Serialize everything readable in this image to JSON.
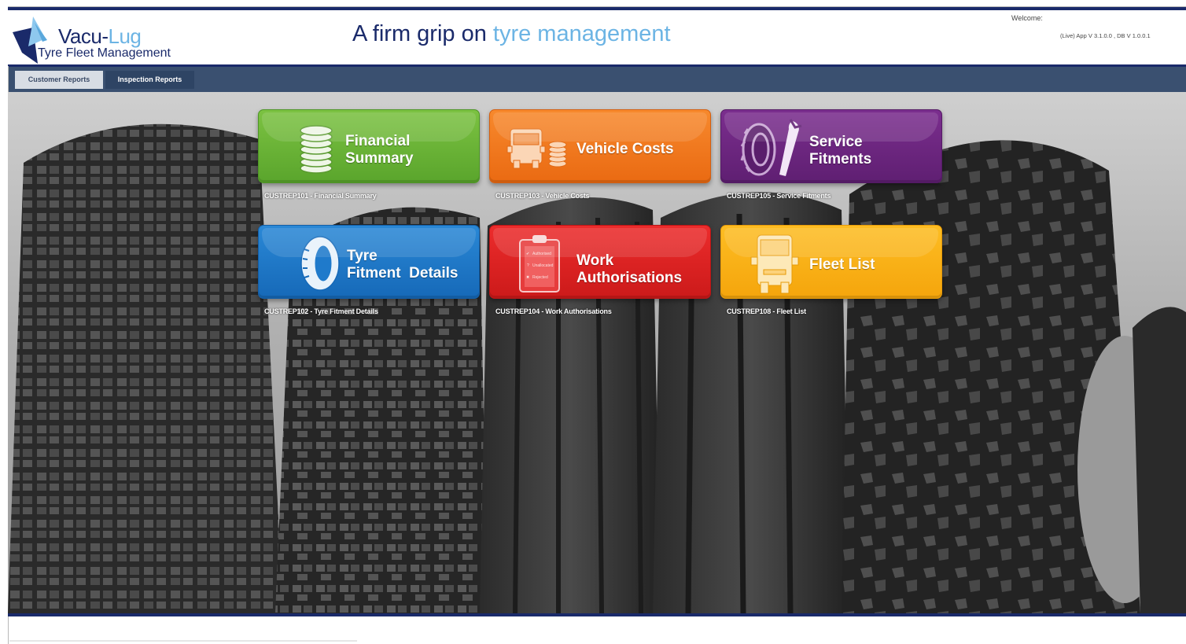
{
  "header": {
    "brand_main": "Vacu-",
    "brand_accent": "Lug",
    "brand_sub": "Tyre Fleet Management",
    "tagline_main": "A firm grip on ",
    "tagline_accent": "tyre management",
    "welcome": "Welcome:",
    "version": "(Live) App V 3.1.0.0 , DB V 1.0.0.1"
  },
  "nav": {
    "tabs": [
      {
        "label": "Customer Reports",
        "active": true
      },
      {
        "label": "Inspection Reports",
        "active": false
      }
    ]
  },
  "tiles": [
    {
      "line1": "Financial",
      "line2": "Summary",
      "caption": "CUSTREP101 - Financial Summary",
      "color": "#6cb83a",
      "icon": "coins-icon"
    },
    {
      "line1": "Vehicle Costs",
      "line2": "",
      "caption": "CUSTREP103 - Vehicle Costs",
      "color": "#f27a22",
      "icon": "truck-coins-icon"
    },
    {
      "line1": "Service",
      "line2": "Fitments",
      "caption": "CUSTREP105 - Service Fitments",
      "color": "#6d2781",
      "icon": "tyre-wrench-icon"
    },
    {
      "line1": "Tyre",
      "line2": "Fitment  Details",
      "caption": "CUSTREP102 - Tyre Fitment Details",
      "color": "#1f7acb",
      "icon": "tyre-icon"
    },
    {
      "line1": "Work",
      "line2": "Authorisations",
      "caption": "CUSTREP104 - Work Authorisations",
      "color": "#e02222",
      "icon": "clipboard-icon"
    },
    {
      "line1": "Fleet List",
      "line2": "",
      "caption": "CUSTREP108 - Fleet List",
      "color": "#fbb116",
      "icon": "truck-icon"
    }
  ],
  "clipboard_lines": [
    "Authorised",
    "Unallocated",
    "Rejected"
  ]
}
